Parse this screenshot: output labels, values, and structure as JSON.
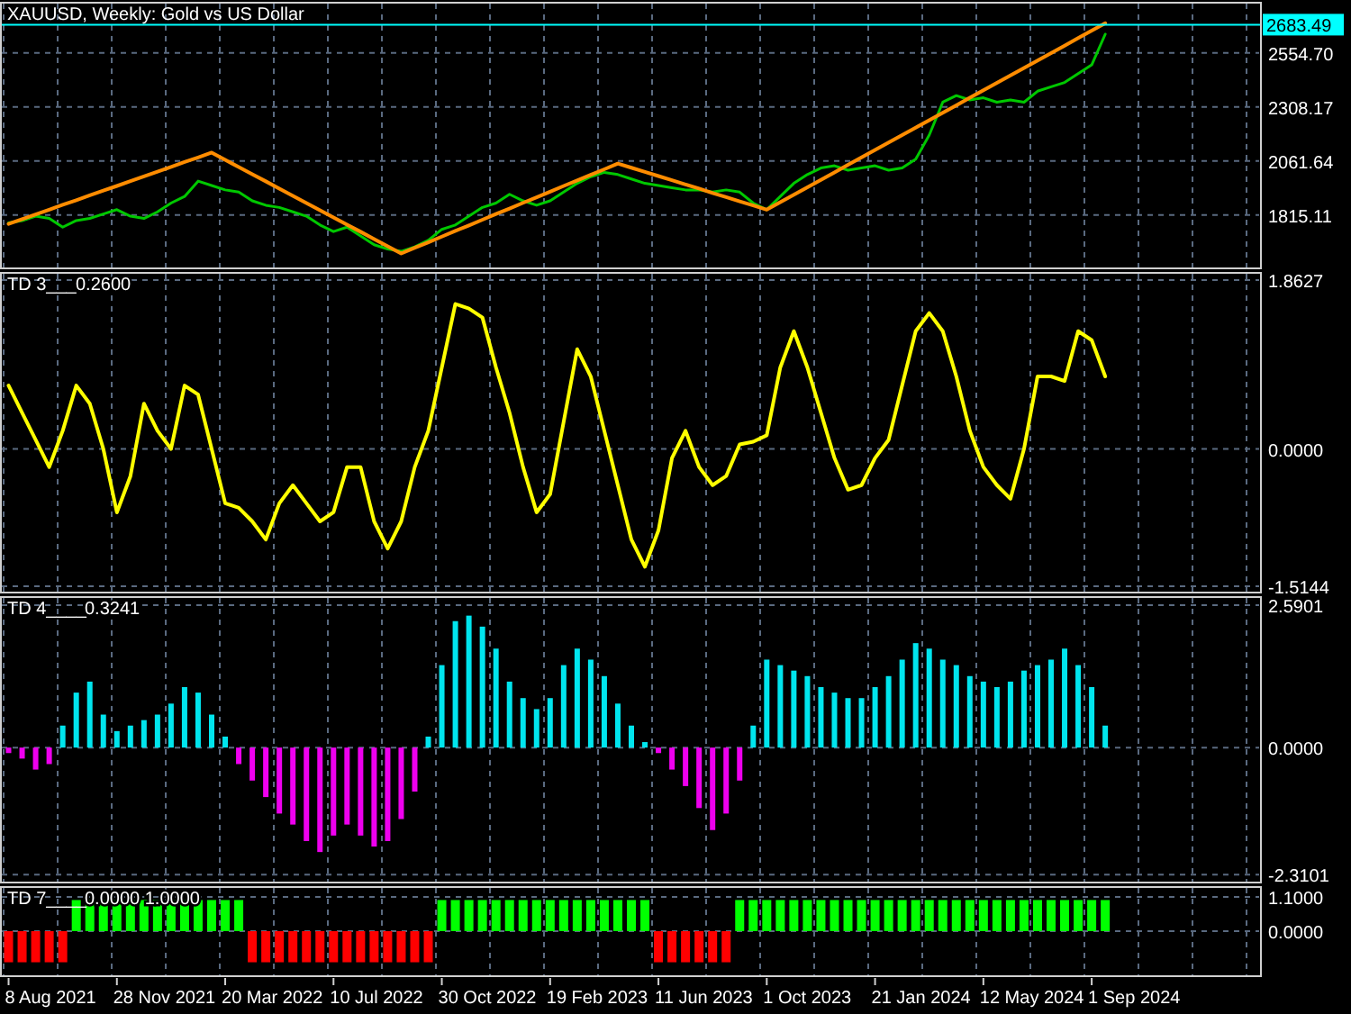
{
  "panels": [
    {
      "kind": "price",
      "title": "XAUUSD, Weekly:  Gold vs US Dollar",
      "chart_data": {
        "type": "line",
        "grid": true,
        "ylim": [
          1564,
          2796
        ],
        "yticks": [
          {
            "value": 2554.7,
            "label": "2554.70"
          },
          {
            "value": 2308.17,
            "label": "2308.17"
          },
          {
            "value": 2061.64,
            "label": "2061.64"
          },
          {
            "value": 1815.11,
            "label": "1815.11"
          }
        ],
        "ref_lines": [
          {
            "axis": "y",
            "value": 2683.49,
            "label": "2683.49",
            "color": "#00ffff"
          }
        ],
        "series": [
          {
            "color": "#00c800",
            "values": [
              1780,
              1790,
              1810,
              1800,
              1760,
              1790,
              1800,
              1820,
              1840,
              1810,
              1800,
              1830,
              1870,
              1900,
              1970,
              1950,
              1930,
              1920,
              1880,
              1860,
              1850,
              1830,
              1810,
              1770,
              1740,
              1760,
              1720,
              1680,
              1660,
              1650,
              1670,
              1700,
              1750,
              1770,
              1810,
              1850,
              1870,
              1910,
              1880,
              1860,
              1880,
              1920,
              1960,
              1990,
              2010,
              2000,
              1980,
              1960,
              1950,
              1940,
              1930,
              1930,
              1920,
              1930,
              1920,
              1870,
              1840,
              1900,
              1960,
              2000,
              2030,
              2040,
              2020,
              2030,
              2040,
              2020,
              2030,
              2070,
              2180,
              2330,
              2360,
              2340,
              2350,
              2330,
              2340,
              2330,
              2380,
              2400,
              2420,
              2460,
              2500,
              2640,
              null,
              null,
              null,
              null,
              null,
              null,
              null,
              null,
              null,
              null,
              null
            ]
          },
          {
            "color": "#ff8c00",
            "values": [
              1775,
              1797,
              1818,
              1840,
              1862,
              1883,
              1905,
              1927,
              1948,
              1970,
              1992,
              2013,
              2035,
              2057,
              2078,
              2100,
              2067,
              2034,
              2001,
              1969,
              1936,
              1903,
              1870,
              1837,
              1804,
              1771,
              1739,
              1706,
              1673,
              1640,
              1666,
              1691,
              1717,
              1743,
              1768,
              1794,
              1820,
              1845,
              1871,
              1896,
              1922,
              1948,
              1973,
              1999,
              2024,
              2050,
              2031,
              2012,
              1993,
              1974,
              1955,
              1936,
              1916,
              1897,
              1878,
              1859,
              1840,
              1874,
              1908,
              1942,
              1976,
              2010,
              2044,
              2078,
              2112,
              2146,
              2180,
              2214,
              2248,
              2282,
              2316,
              2350,
              2384,
              2418,
              2452,
              2486,
              2520,
              2554,
              2588,
              2622,
              2656,
              2690,
              null,
              null,
              null,
              null,
              null,
              null,
              null,
              null,
              null,
              null,
              null
            ]
          }
        ]
      }
    },
    {
      "kind": "line",
      "title": "TD 3___",
      "reading": "0.2600",
      "chart_data": {
        "type": "line",
        "grid": true,
        "ylim": [
          -1.605,
          1.973
        ],
        "yticks": [
          {
            "value": 1.8627,
            "label": "1.8627"
          },
          {
            "value": 0,
            "label": "0.0000"
          },
          {
            "value": -1.5144,
            "label": "-1.5144"
          }
        ],
        "series": [
          {
            "color": "#ffff00",
            "values": [
              0.7,
              0.4,
              0.1,
              -0.2,
              0.2,
              0.7,
              0.5,
              0.0,
              -0.7,
              -0.3,
              0.5,
              0.2,
              0.0,
              0.7,
              0.6,
              0.0,
              -0.6,
              -0.65,
              -0.8,
              -1.0,
              -0.6,
              -0.4,
              -0.6,
              -0.8,
              -0.7,
              -0.2,
              -0.2,
              -0.8,
              -1.1,
              -0.8,
              -0.2,
              0.2,
              0.9,
              1.6,
              1.55,
              1.45,
              0.9,
              0.4,
              -0.2,
              -0.7,
              -0.5,
              0.3,
              1.1,
              0.8,
              0.2,
              -0.4,
              -1.0,
              -1.3,
              -0.9,
              -0.1,
              0.2,
              -0.2,
              -0.4,
              -0.3,
              0.05,
              0.08,
              0.15,
              0.9,
              1.3,
              0.9,
              0.4,
              -0.1,
              -0.45,
              -0.4,
              -0.1,
              0.1,
              0.7,
              1.3,
              1.5,
              1.3,
              0.8,
              0.2,
              -0.2,
              -0.4,
              -0.55,
              0.0,
              0.8,
              0.8,
              0.75,
              1.3,
              1.2,
              0.8,
              null,
              null,
              null,
              null,
              null,
              null,
              null,
              null,
              null,
              null,
              null
            ]
          }
        ]
      }
    },
    {
      "kind": "histogram",
      "title": "TD 4____",
      "reading": "0.3241",
      "chart_data": {
        "type": "bar",
        "grid": true,
        "ylim": [
          -2.487,
          2.787
        ],
        "yticks": [
          {
            "value": 2.5901,
            "label": "2.5901"
          },
          {
            "value": 0,
            "label": "0.0000"
          },
          {
            "value": -2.3101,
            "label": "-2.3101"
          }
        ],
        "series": [
          {
            "color": "#00e5ee",
            "values": [
              null,
              null,
              null,
              null,
              0.4,
              1.0,
              1.2,
              0.6,
              0.3,
              0.4,
              0.5,
              0.6,
              0.8,
              1.1,
              1.0,
              0.6,
              0.2,
              null,
              null,
              null,
              null,
              null,
              null,
              null,
              null,
              null,
              null,
              null,
              null,
              null,
              null,
              0.2,
              1.5,
              2.3,
              2.4,
              2.2,
              1.8,
              1.2,
              0.9,
              0.7,
              0.9,
              1.5,
              1.8,
              1.6,
              1.3,
              0.8,
              0.4,
              0.1,
              null,
              null,
              null,
              null,
              null,
              null,
              null,
              0.4,
              1.6,
              1.5,
              1.4,
              1.3,
              1.1,
              1.0,
              0.9,
              0.9,
              1.1,
              1.3,
              1.6,
              1.9,
              1.8,
              1.6,
              1.5,
              1.3,
              1.2,
              1.1,
              1.2,
              1.4,
              1.5,
              1.6,
              1.8,
              1.5,
              1.1,
              0.4,
              null,
              null,
              null,
              null,
              null,
              null,
              null,
              null,
              null,
              null,
              null
            ]
          },
          {
            "color": "#ee00ee",
            "values": [
              -0.1,
              -0.2,
              -0.4,
              -0.3,
              null,
              null,
              null,
              null,
              null,
              null,
              null,
              null,
              null,
              null,
              null,
              null,
              null,
              -0.3,
              -0.6,
              -0.9,
              -1.2,
              -1.4,
              -1.7,
              -1.9,
              -1.6,
              -1.4,
              -1.6,
              -1.8,
              -1.7,
              -1.3,
              -0.8,
              null,
              null,
              null,
              null,
              null,
              null,
              null,
              null,
              null,
              null,
              null,
              null,
              null,
              null,
              null,
              null,
              null,
              -0.1,
              -0.4,
              -0.7,
              -1.1,
              -1.5,
              -1.2,
              -0.6,
              null,
              null,
              null,
              null,
              null,
              null,
              null,
              null,
              null,
              null,
              null,
              null,
              null,
              null,
              null,
              null,
              null,
              null,
              null,
              null,
              null,
              null,
              null,
              null,
              null,
              null,
              null,
              null,
              null,
              null,
              null,
              null,
              null,
              null,
              null,
              null,
              null,
              null
            ]
          }
        ]
      }
    },
    {
      "kind": "signal",
      "title": "TD 7____",
      "reading": "0.0000 1.0000",
      "chart_data": {
        "type": "bar",
        "grid": true,
        "ylim": [
          -1.505,
          1.505
        ],
        "yticks": [
          {
            "value": 1.1,
            "label": "1.1000"
          },
          {
            "value": 0,
            "label": "0.0000"
          }
        ],
        "series": [
          {
            "color": "#00ff00",
            "values": [
              null,
              null,
              null,
              null,
              null,
              1,
              1,
              1,
              1,
              1,
              1,
              1,
              1,
              1,
              1,
              1,
              1,
              1,
              null,
              null,
              null,
              null,
              null,
              null,
              null,
              null,
              null,
              null,
              null,
              null,
              null,
              null,
              1,
              1,
              1,
              1,
              1,
              1,
              1,
              1,
              1,
              1,
              1,
              1,
              1,
              1,
              1,
              1,
              null,
              null,
              null,
              null,
              null,
              null,
              1,
              1,
              1,
              1,
              1,
              1,
              1,
              1,
              1,
              1,
              1,
              1,
              1,
              1,
              1,
              1,
              1,
              1,
              1,
              1,
              1,
              1,
              1,
              1,
              1,
              1,
              1,
              1,
              null,
              null,
              null,
              null,
              null,
              null,
              null,
              null,
              null,
              null,
              null
            ]
          },
          {
            "color": "#ff0000",
            "values": [
              -1,
              -1,
              -1,
              -1,
              -1,
              null,
              null,
              null,
              null,
              null,
              null,
              null,
              null,
              null,
              null,
              null,
              null,
              null,
              -1,
              -1,
              -1,
              -1,
              -1,
              -1,
              -1,
              -1,
              -1,
              -1,
              -1,
              -1,
              -1,
              -1,
              null,
              null,
              null,
              null,
              null,
              null,
              null,
              null,
              null,
              null,
              null,
              null,
              null,
              null,
              null,
              null,
              -1,
              -1,
              -1,
              -1,
              -1,
              -1,
              null,
              null,
              null,
              null,
              null,
              null,
              null,
              null,
              null,
              null,
              null,
              null,
              null,
              null,
              null,
              null,
              null,
              null,
              null,
              null,
              null,
              null,
              null,
              null,
              null,
              null,
              null,
              null,
              null,
              null,
              null,
              null,
              null,
              null,
              null,
              null,
              null,
              null,
              null
            ]
          }
        ]
      }
    }
  ],
  "time_axis": {
    "labels": [
      "8 Aug 2021",
      "28 Nov 2021",
      "20 Mar 2022",
      "10 Jul 2022",
      "30 Oct 2022",
      "19 Feb 2023",
      "11 Jun 2023",
      "1 Oct 2023",
      "21 Jan 2024",
      "12 May 2024",
      "1 Sep 2024"
    ]
  }
}
